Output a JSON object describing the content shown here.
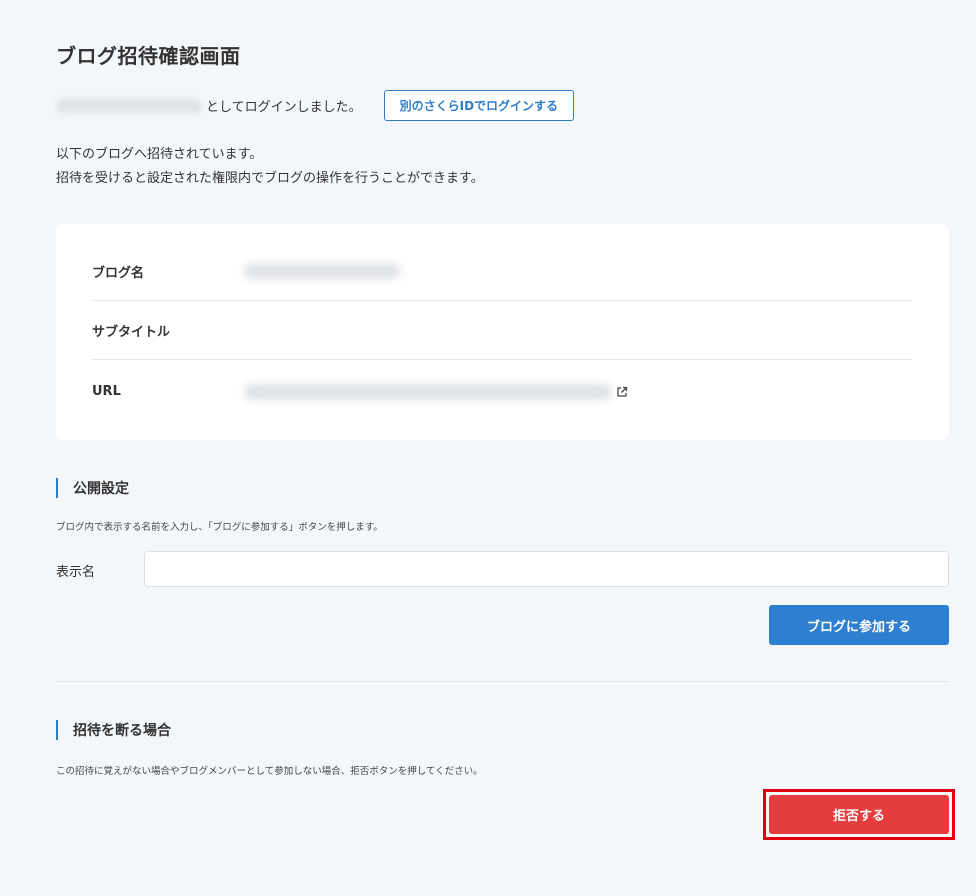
{
  "page": {
    "title": "ブログ招待確認画面"
  },
  "login": {
    "status_text": "としてログインしました。",
    "switch_button": "別のさくらIDでログインする"
  },
  "intro": {
    "line1": "以下のブログへ招待されています。",
    "line2": "招待を受けると設定された権限内でブログの操作を行うことができます。"
  },
  "blog_info": {
    "name_label": "ブログ名",
    "subtitle_label": "サブタイトル",
    "url_label": "URL",
    "external_link_icon": "external-link-icon"
  },
  "public_settings": {
    "heading": "公開設定",
    "description": "ブログ内で表示する名前を入力し、「ブログに参加する」ボタンを押します。",
    "display_name_label": "表示名",
    "display_name_value": "",
    "join_button": "ブログに参加する"
  },
  "decline": {
    "heading": "招待を断る場合",
    "description": "この招待に覚えがない場合やブログメンバーとして参加しない場合、拒否ボタンを押してください。",
    "reject_button": "拒否する"
  },
  "colors": {
    "accent": "#2f7dc9",
    "danger": "#e53d3d",
    "highlight": "#e0000f",
    "background": "#f4f7fa"
  }
}
